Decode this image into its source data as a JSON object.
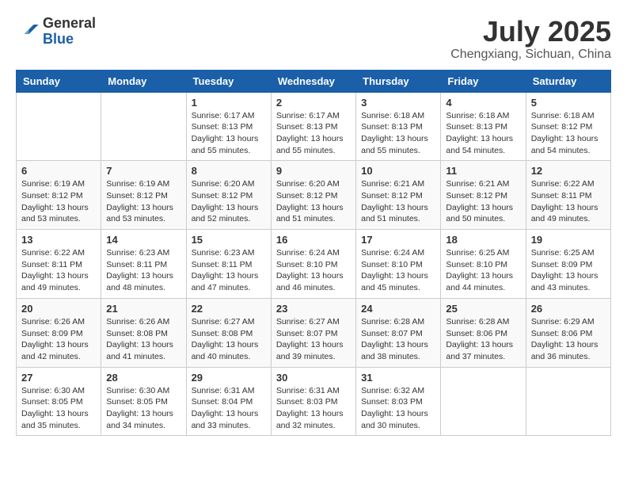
{
  "header": {
    "logo_general": "General",
    "logo_blue": "Blue",
    "month_year": "July 2025",
    "location": "Chengxiang, Sichuan, China"
  },
  "calendar": {
    "days_of_week": [
      "Sunday",
      "Monday",
      "Tuesday",
      "Wednesday",
      "Thursday",
      "Friday",
      "Saturday"
    ],
    "weeks": [
      [
        {
          "day": "",
          "info": ""
        },
        {
          "day": "",
          "info": ""
        },
        {
          "day": "1",
          "info": "Sunrise: 6:17 AM\nSunset: 8:13 PM\nDaylight: 13 hours and 55 minutes."
        },
        {
          "day": "2",
          "info": "Sunrise: 6:17 AM\nSunset: 8:13 PM\nDaylight: 13 hours and 55 minutes."
        },
        {
          "day": "3",
          "info": "Sunrise: 6:18 AM\nSunset: 8:13 PM\nDaylight: 13 hours and 55 minutes."
        },
        {
          "day": "4",
          "info": "Sunrise: 6:18 AM\nSunset: 8:13 PM\nDaylight: 13 hours and 54 minutes."
        },
        {
          "day": "5",
          "info": "Sunrise: 6:18 AM\nSunset: 8:12 PM\nDaylight: 13 hours and 54 minutes."
        }
      ],
      [
        {
          "day": "6",
          "info": "Sunrise: 6:19 AM\nSunset: 8:12 PM\nDaylight: 13 hours and 53 minutes."
        },
        {
          "day": "7",
          "info": "Sunrise: 6:19 AM\nSunset: 8:12 PM\nDaylight: 13 hours and 53 minutes."
        },
        {
          "day": "8",
          "info": "Sunrise: 6:20 AM\nSunset: 8:12 PM\nDaylight: 13 hours and 52 minutes."
        },
        {
          "day": "9",
          "info": "Sunrise: 6:20 AM\nSunset: 8:12 PM\nDaylight: 13 hours and 51 minutes."
        },
        {
          "day": "10",
          "info": "Sunrise: 6:21 AM\nSunset: 8:12 PM\nDaylight: 13 hours and 51 minutes."
        },
        {
          "day": "11",
          "info": "Sunrise: 6:21 AM\nSunset: 8:12 PM\nDaylight: 13 hours and 50 minutes."
        },
        {
          "day": "12",
          "info": "Sunrise: 6:22 AM\nSunset: 8:11 PM\nDaylight: 13 hours and 49 minutes."
        }
      ],
      [
        {
          "day": "13",
          "info": "Sunrise: 6:22 AM\nSunset: 8:11 PM\nDaylight: 13 hours and 49 minutes."
        },
        {
          "day": "14",
          "info": "Sunrise: 6:23 AM\nSunset: 8:11 PM\nDaylight: 13 hours and 48 minutes."
        },
        {
          "day": "15",
          "info": "Sunrise: 6:23 AM\nSunset: 8:11 PM\nDaylight: 13 hours and 47 minutes."
        },
        {
          "day": "16",
          "info": "Sunrise: 6:24 AM\nSunset: 8:10 PM\nDaylight: 13 hours and 46 minutes."
        },
        {
          "day": "17",
          "info": "Sunrise: 6:24 AM\nSunset: 8:10 PM\nDaylight: 13 hours and 45 minutes."
        },
        {
          "day": "18",
          "info": "Sunrise: 6:25 AM\nSunset: 8:10 PM\nDaylight: 13 hours and 44 minutes."
        },
        {
          "day": "19",
          "info": "Sunrise: 6:25 AM\nSunset: 8:09 PM\nDaylight: 13 hours and 43 minutes."
        }
      ],
      [
        {
          "day": "20",
          "info": "Sunrise: 6:26 AM\nSunset: 8:09 PM\nDaylight: 13 hours and 42 minutes."
        },
        {
          "day": "21",
          "info": "Sunrise: 6:26 AM\nSunset: 8:08 PM\nDaylight: 13 hours and 41 minutes."
        },
        {
          "day": "22",
          "info": "Sunrise: 6:27 AM\nSunset: 8:08 PM\nDaylight: 13 hours and 40 minutes."
        },
        {
          "day": "23",
          "info": "Sunrise: 6:27 AM\nSunset: 8:07 PM\nDaylight: 13 hours and 39 minutes."
        },
        {
          "day": "24",
          "info": "Sunrise: 6:28 AM\nSunset: 8:07 PM\nDaylight: 13 hours and 38 minutes."
        },
        {
          "day": "25",
          "info": "Sunrise: 6:28 AM\nSunset: 8:06 PM\nDaylight: 13 hours and 37 minutes."
        },
        {
          "day": "26",
          "info": "Sunrise: 6:29 AM\nSunset: 8:06 PM\nDaylight: 13 hours and 36 minutes."
        }
      ],
      [
        {
          "day": "27",
          "info": "Sunrise: 6:30 AM\nSunset: 8:05 PM\nDaylight: 13 hours and 35 minutes."
        },
        {
          "day": "28",
          "info": "Sunrise: 6:30 AM\nSunset: 8:05 PM\nDaylight: 13 hours and 34 minutes."
        },
        {
          "day": "29",
          "info": "Sunrise: 6:31 AM\nSunset: 8:04 PM\nDaylight: 13 hours and 33 minutes."
        },
        {
          "day": "30",
          "info": "Sunrise: 6:31 AM\nSunset: 8:03 PM\nDaylight: 13 hours and 32 minutes."
        },
        {
          "day": "31",
          "info": "Sunrise: 6:32 AM\nSunset: 8:03 PM\nDaylight: 13 hours and 30 minutes."
        },
        {
          "day": "",
          "info": ""
        },
        {
          "day": "",
          "info": ""
        }
      ]
    ]
  }
}
